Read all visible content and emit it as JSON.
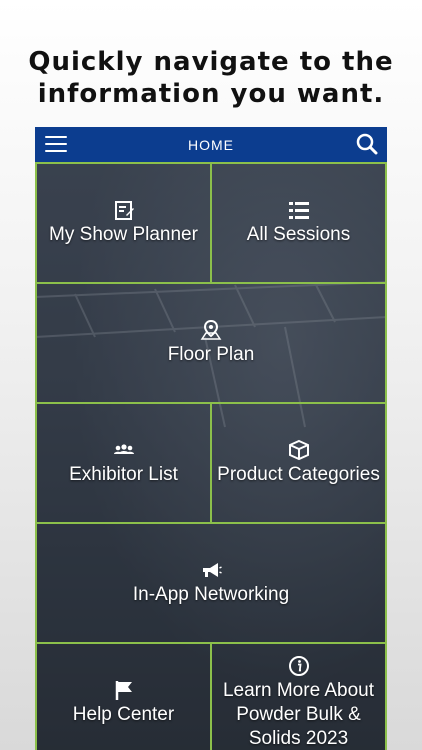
{
  "headline": {
    "line1": "Quickly navigate to the",
    "line2": "information you want."
  },
  "navbar": {
    "title": "HOME",
    "menu_icon": "hamburger-menu-icon",
    "search_icon": "search-icon",
    "background": "#0c3d8f",
    "accent": "#8cc04b"
  },
  "tiles": [
    {
      "label": "My Show Planner",
      "icon": "planner-icon"
    },
    {
      "label": "All Sessions",
      "icon": "list-icon"
    },
    {
      "label": "Floor Plan",
      "icon": "map-pin-icon"
    },
    {
      "label": "Exhibitor List",
      "icon": "people-icon"
    },
    {
      "label": "Product Categories",
      "icon": "box-icon"
    },
    {
      "label": "In-App Networking",
      "icon": "megaphone-icon"
    },
    {
      "label": "Help Center",
      "icon": "flag-icon"
    },
    {
      "label": "Learn More About Powder Bulk & Solids 2023",
      "icon": "info-icon"
    }
  ]
}
